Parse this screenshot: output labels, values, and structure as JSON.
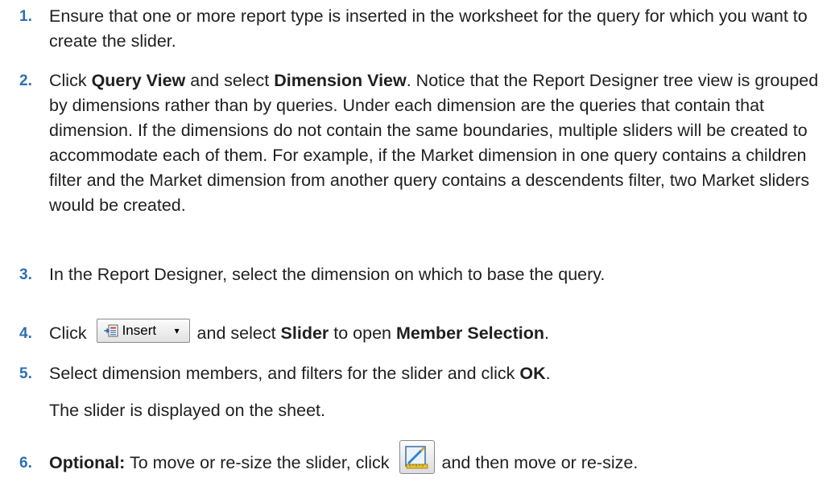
{
  "steps": [
    {
      "number": "1.",
      "text": "Ensure that one or more report type is inserted in the worksheet for the query for which you want to create the slider."
    },
    {
      "number": "2.",
      "pre": "Click ",
      "bold1": "Query View",
      "mid": " and select ",
      "bold2": "Dimension View",
      "post": ". Notice that the Report Designer tree view is grouped by dimensions rather than by queries. Under each dimension are the queries that contain that dimension. If the dimensions do not contain the same boundaries, multiple sliders will be created to accommodate each of them. For example, if the Market dimension in one query contains a children filter and the Market dimension from another query contains a descendents filter, two Market sliders would be created."
    },
    {
      "number": "3.",
      "text": "In the Report Designer, select the dimension on which to base the query."
    },
    {
      "number": "4.",
      "pre": "Click ",
      "button_label": "Insert",
      "button_caret": "▾",
      "mid": " and select ",
      "bold1": "Slider",
      "mid2": " to open ",
      "bold2": "Member Selection",
      "post": "."
    },
    {
      "number": "5.",
      "pre": "Select dimension members, and filters for the slider and click ",
      "bold1": "OK",
      "post": ".",
      "result": "The slider is displayed on the sheet."
    },
    {
      "number": "6.",
      "bold1": "Optional:",
      "pre": " To move or re-size the slider, click ",
      "post": " and then move or re-size."
    }
  ],
  "colors": {
    "step_number": "#2e6fb2",
    "text": "#1f1f1f"
  },
  "icons": {
    "insert": "insert-report-icon",
    "design_mode": "design-mode-icon"
  }
}
